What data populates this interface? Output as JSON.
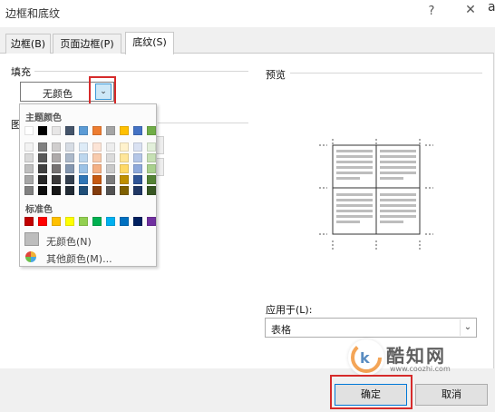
{
  "window": {
    "title": "边框和底纹",
    "help": "?",
    "close": "✕",
    "edge_char": "a"
  },
  "tabs": [
    {
      "label": "边框(B)"
    },
    {
      "label": "页面边框(P)"
    },
    {
      "label": "底纹(S)",
      "active": true
    }
  ],
  "fill": {
    "label": "填充",
    "value": "无颜色",
    "dropdown_icon": "chevron-down-icon"
  },
  "pattern": {
    "label": "图"
  },
  "palette": {
    "theme_title": "主题颜色",
    "theme_colors": [
      [
        "#FFFFFF",
        "#000000",
        "#E7E6E6",
        "#44546A",
        "#5B9BD5",
        "#ED7D31",
        "#A5A5A5",
        "#FFC000",
        "#4472C4",
        "#70AD47"
      ],
      [
        "#F2F2F2",
        "#808080",
        "#D0CECE",
        "#D6DCE4",
        "#DDEBF7",
        "#FCE4D6",
        "#EDEDED",
        "#FFF2CC",
        "#D9E1F2",
        "#E2EFDA"
      ],
      [
        "#D9D9D9",
        "#595959",
        "#AEAAAA",
        "#ACB9CA",
        "#BDD7EE",
        "#F8CBAD",
        "#DBDBDB",
        "#FFE699",
        "#B4C6E7",
        "#C6E0B4"
      ],
      [
        "#BFBFBF",
        "#404040",
        "#757171",
        "#8497B0",
        "#9BC2E6",
        "#F4B084",
        "#C9C9C9",
        "#FFD966",
        "#8EA9DB",
        "#A9D08E"
      ],
      [
        "#A6A6A6",
        "#262626",
        "#3A3838",
        "#333F4F",
        "#2F75B5",
        "#C65911",
        "#7B7B7B",
        "#BF8F00",
        "#2F5496",
        "#548235"
      ],
      [
        "#808080",
        "#0D0D0D",
        "#161616",
        "#222B35",
        "#1F4E78",
        "#833C0C",
        "#525252",
        "#7F6000",
        "#203764",
        "#375623"
      ]
    ],
    "standard_title": "标准色",
    "standard_colors": [
      "#C00000",
      "#FF0000",
      "#FFC000",
      "#FFFF00",
      "#92D050",
      "#00B050",
      "#00B0F0",
      "#0070C0",
      "#002060",
      "#7030A0"
    ],
    "no_color_label": "无颜色(N)",
    "more_colors_label": "其他颜色(M)..."
  },
  "preview": {
    "label": "预览"
  },
  "apply_to": {
    "label": "应用于(L):",
    "value": "表格"
  },
  "buttons": {
    "ok": "确定",
    "cancel": "取消"
  },
  "watermark": {
    "text": "酷知网",
    "url": "www.coozhi.com"
  },
  "colors": {
    "highlight_red": "#D62B2B",
    "focus_blue": "#0078D7"
  }
}
